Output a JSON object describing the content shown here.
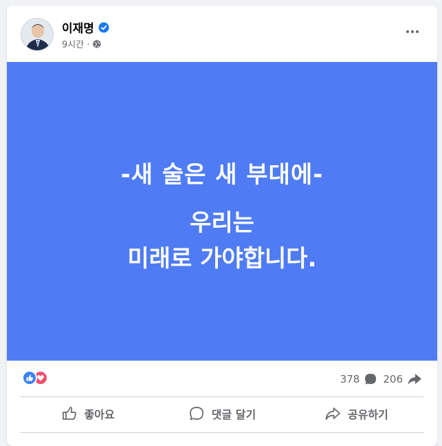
{
  "post": {
    "author": "이재명",
    "time": "9시간 ·",
    "verified_icon": "verified-badge-icon",
    "privacy_icon": "globe-icon"
  },
  "image_text": {
    "line1": "-새 술은 새 부대에-",
    "line2": "우리는",
    "line3": "미래로 가야합니다."
  },
  "stats": {
    "comments": "378",
    "shares": "206"
  },
  "actions": {
    "like": "좋아요",
    "comment": "댓글 달기",
    "share": "공유하기"
  },
  "colors": {
    "image_bg": "#4f7cf4",
    "verified": "#1877f2",
    "like": "#3b82f6",
    "love": "#f0506e"
  }
}
